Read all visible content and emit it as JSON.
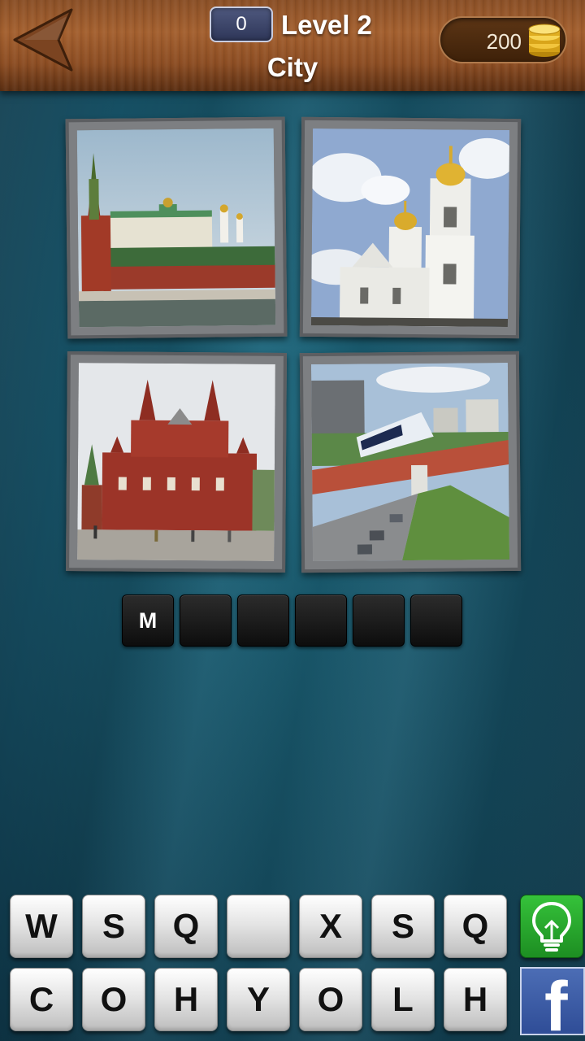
{
  "header": {
    "score": "0",
    "level_title": "Level 2",
    "category": "City",
    "coins": "200"
  },
  "photos": [
    {
      "subject": "red brick tower and palace along a river"
    },
    {
      "subject": "white bell tower with golden domes"
    },
    {
      "subject": "red historical building on a square"
    },
    {
      "subject": "monorail train over a road"
    }
  ],
  "answer": {
    "slots": [
      "M",
      "",
      "",
      "",
      "",
      ""
    ]
  },
  "keyboard": {
    "row1": [
      "W",
      "S",
      "Q",
      "",
      "X",
      "S",
      "Q"
    ],
    "row2": [
      "C",
      "O",
      "H",
      "Y",
      "O",
      "L",
      "H"
    ]
  },
  "buttons": {
    "hint_icon": "lightbulb-icon",
    "facebook_label": "f"
  },
  "colors": {
    "hint": "#2aa82f",
    "facebook": "#3b5998",
    "background": "#164f63"
  }
}
